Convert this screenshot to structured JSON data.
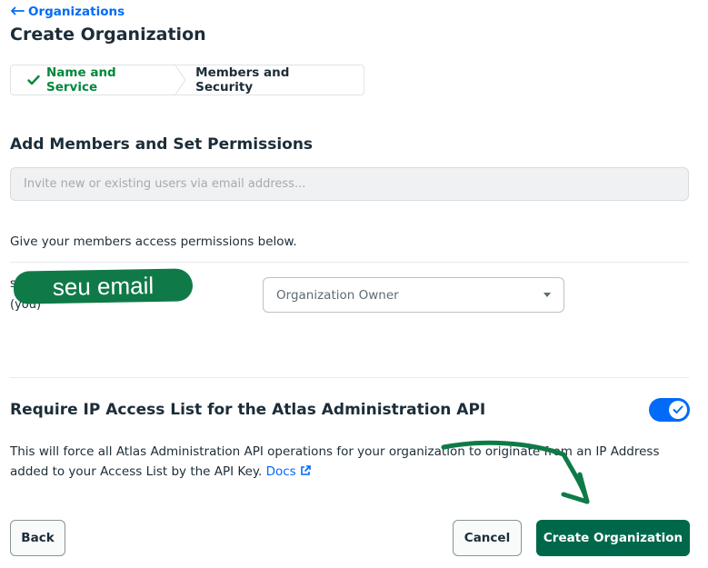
{
  "header": {
    "back_label": "Organizations",
    "title": "Create Organization"
  },
  "stepper": {
    "steps": [
      {
        "label": "Name and Service",
        "status": "complete"
      },
      {
        "label": "Members and Security",
        "status": "current"
      }
    ]
  },
  "members": {
    "section_title": "Add Members and Set Permissions",
    "invite_placeholder": "Invite new or existing users via email address...",
    "permissions_text": "Give your members access permissions below.",
    "member": {
      "email_prefix": "s",
      "you_label": "(you)",
      "redaction_text": "seu email",
      "role": "Organization Owner"
    }
  },
  "ip_access": {
    "title": "Require IP Access List for the Atlas Administration API",
    "toggle_on": true,
    "description": "This will force all Atlas Administration API operations for your organization to originate from an IP Address added to your Access List by the API Key.",
    "docs_label": "Docs"
  },
  "footer": {
    "back_label": "Back",
    "cancel_label": "Cancel",
    "create_label": "Create Organization"
  },
  "colors": {
    "accent_blue": "#016bf8",
    "success_green": "#00883a",
    "primary_button": "#00684a",
    "annotation_green": "#0f7a48"
  }
}
